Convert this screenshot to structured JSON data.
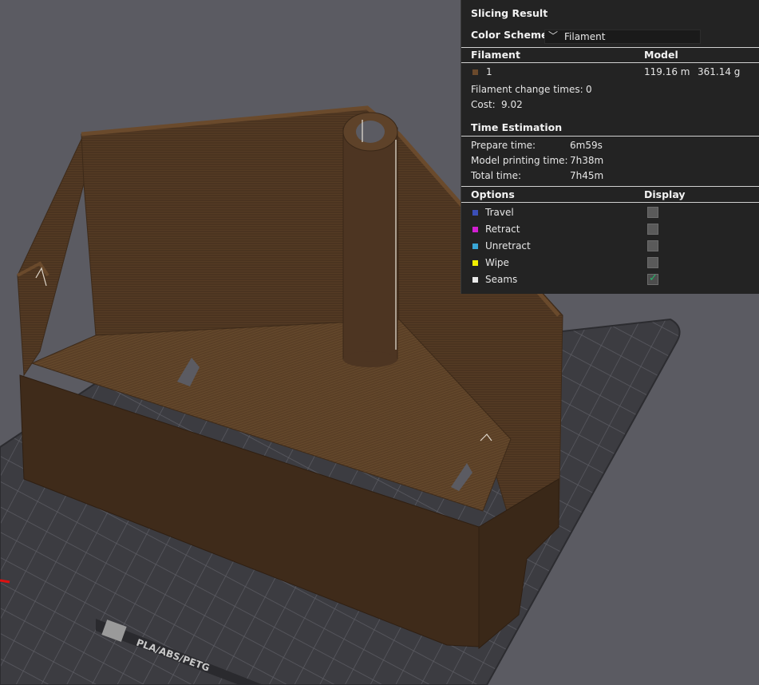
{
  "panel": {
    "title": "Slicing Result",
    "color_scheme_label": "Color Scheme",
    "color_scheme_value": "Filament",
    "filament_header": "Filament",
    "model_header": "Model",
    "filament_row": {
      "index": "1",
      "color": "#6b4a2c",
      "length": "119.16 m",
      "weight": "361.14 g"
    },
    "filament_change_label": "Filament change times:",
    "filament_change_value": "0",
    "cost_label": "Cost:",
    "cost_value": "9.02",
    "time_header": "Time Estimation",
    "prepare_label": "Prepare time:",
    "prepare_value": "6m59s",
    "model_time_label": "Model printing time:",
    "model_time_value": "7h38m",
    "total_label": "Total time:",
    "total_value": "7h45m",
    "options_header": "Options",
    "display_header": "Display",
    "options": [
      {
        "label": "Travel",
        "color": "#3b4fb8",
        "checked": false
      },
      {
        "label": "Retract",
        "color": "#d21fd2",
        "checked": false
      },
      {
        "label": "Unretract",
        "color": "#39a6d6",
        "checked": false
      },
      {
        "label": "Wipe",
        "color": "#f2ee00",
        "checked": false
      },
      {
        "label": "Seams",
        "color": "#eaeaea",
        "checked": true
      }
    ]
  },
  "plate": {
    "label": "PLA/ABS/PETG"
  },
  "colors": {
    "background": "#5b5b62",
    "model": "#4a3320",
    "model_top": "#6b4a2c",
    "plate": "#3b3b40",
    "panel": "#232323"
  }
}
